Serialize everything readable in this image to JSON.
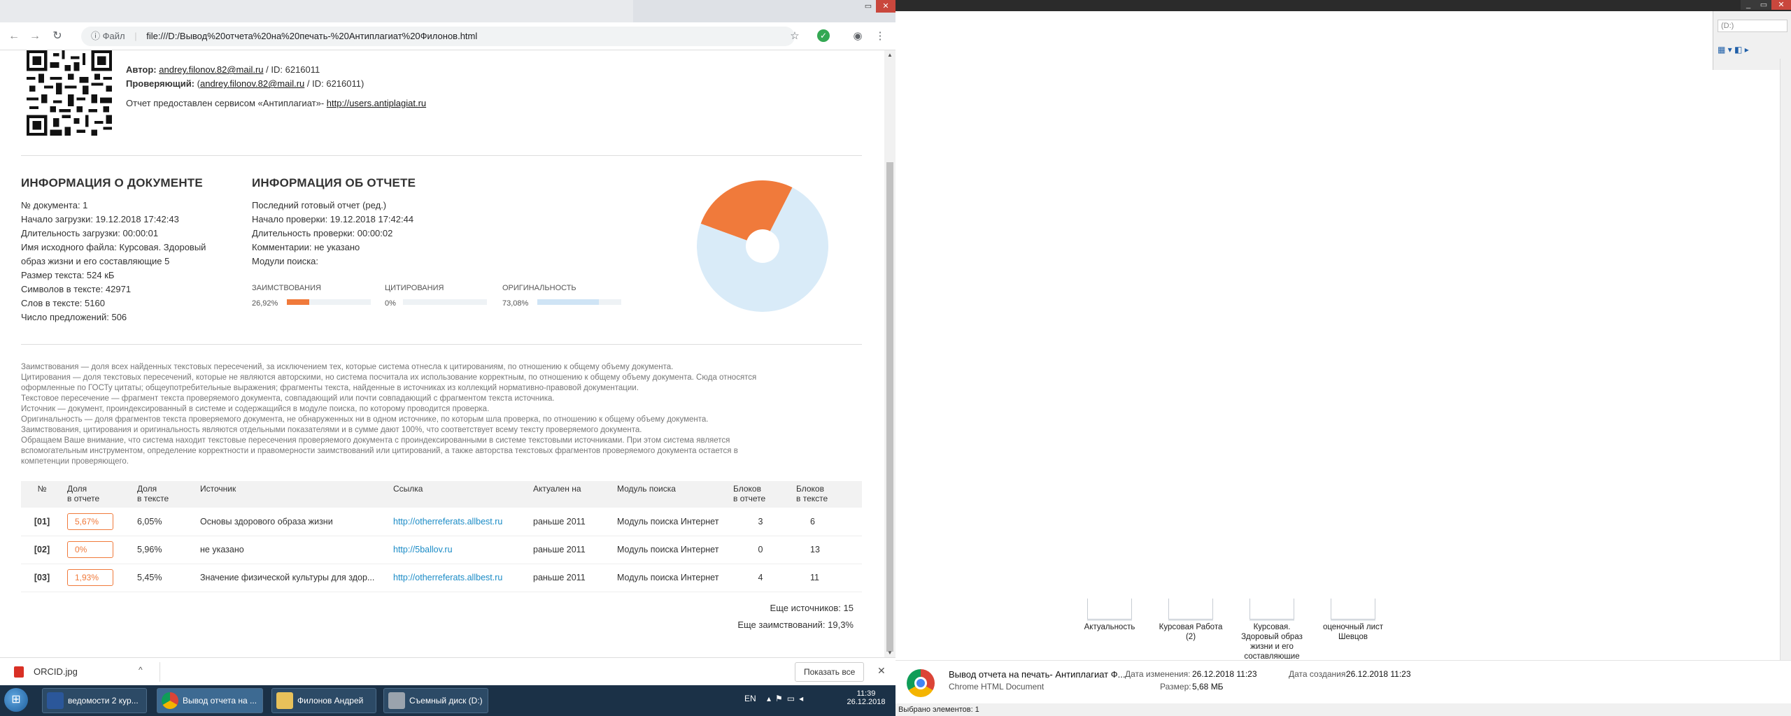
{
  "browser": {
    "url_label": "Файл",
    "url": "file:///D:/Вывод%20отчета%20на%20печать-%20Антиплагиат%20Филонов.html"
  },
  "report": {
    "author_label": "Автор:",
    "author_email": "andrey.filonov.82@mail.ru",
    "author_id": " / ID: 6216011",
    "checker_label": "Проверяющий:",
    "checker_email": "andrey.filonov.82@mail.ru",
    "checker_prefix": "(",
    "checker_id": " / ID: 6216011)",
    "service_text": "Отчет предоставлен сервисом «Антиплагиат»- ",
    "service_link": "http://users.antiplagiat.ru"
  },
  "doc_info": {
    "title": "ИНФОРМАЦИЯ О ДОКУМЕНТЕ",
    "lines": [
      "№ документа: 1",
      "Начало загрузки: 19.12.2018 17:42:43",
      "Длительность загрузки: 00:00:01",
      "Имя исходного файла: Курсовая. Здоровый",
      "образ жизни и его составляющие 5",
      "Размер текста: 524 кБ",
      "Символов в тексте: 42971",
      "Слов в тексте: 5160",
      "Число предложений: 506"
    ]
  },
  "report_info": {
    "title": "ИНФОРМАЦИЯ ОБ ОТЧЕТЕ",
    "lines": [
      "Последний готовый отчет (ред.)",
      "Начало проверки: 19.12.2018 17:42:44",
      "Длительность проверки: 00:00:02",
      "Комментарии: не указано",
      "Модули поиска:"
    ]
  },
  "metrics": [
    {
      "label": "ЗАИМСТВОВАНИЯ",
      "value": "26,92%",
      "fraction": 0.2692,
      "color": "#f07a3b"
    },
    {
      "label": "ЦИТИРОВАНИЯ",
      "value": "0%",
      "fraction": 0,
      "color": "#7cc36b"
    },
    {
      "label": "ОРИГИНАЛЬНОСТЬ",
      "value": "73,08%",
      "fraction": 0.7308,
      "color": "#cfe4f5"
    }
  ],
  "chart_data": {
    "type": "pie",
    "categories": [
      "Заимствования",
      "Цитирования",
      "Оригинальность"
    ],
    "values": [
      26.92,
      0,
      73.08
    ],
    "colors": [
      "#f07a3b",
      "#7cc36b",
      "#d9ebf8"
    ]
  },
  "legend_lines": [
    "Заимствования — доля всех найденных текстовых пересечений, за исключением тех, которые система отнесла к цитированиям, по отношению к общему объему документа.",
    "Цитирования — доля текстовых пересечений, которые не являются авторскими, но система посчитала их использование корректным, по отношению к общему объему документа. Сюда относятся",
    "оформленные по ГОСТу цитаты; общеупотребительные выражения; фрагменты текста, найденные в источниках из коллекций нормативно-правовой документации.",
    "Текстовое пересечение — фрагмент текста проверяемого документа, совпадающий или почти совпадающий с фрагментом текста источника.",
    "Источник — документ, проиндексированный в системе и содержащийся в модуле поиска, по которому проводится проверка.",
    "Оригинальность — доля фрагментов текста проверяемого документа, не обнаруженных ни в одном источнике, по которым шла проверка, по отношению к общему объему документа.",
    "Заимствования, цитирования и оригинальность являются отдельными показателями и в сумме дают 100%, что соответствует всему тексту проверяемого документа.",
    "Обращаем Ваше внимание, что система находит текстовые пересечения проверяемого документа с проиндексированными в системе текстовыми источниками. При этом система является",
    "вспомогательным инструментом, определение корректности и правомерности заимствований или цитирований, а также авторства текстовых фрагментов проверяемого документа остается в",
    "компетенции проверяющего."
  ],
  "table": {
    "headers": [
      "№",
      "Доля\nв отчете",
      "Доля\nв тексте",
      "Источник",
      "Ссылка",
      "Актуален на",
      "Модуль поиска",
      "Блоков\nв отчете",
      "Блоков\nв тексте"
    ],
    "rows": [
      [
        "[01]",
        "5,67%",
        "6,05%",
        "Основы здорового образа жизни",
        "http://otherreferats.allbest.ru",
        "раньше 2011",
        "Модуль поиска Интернет",
        "3",
        "6"
      ],
      [
        "[02]",
        "0%",
        "5,96%",
        "не указано",
        "http://5ballov.ru",
        "раньше 2011",
        "Модуль поиска Интернет",
        "0",
        "13"
      ],
      [
        "[03]",
        "1,93%",
        "5,45%",
        "Значение физической культуры для здор...",
        "http://otherreferats.allbest.ru",
        "раньше 2011",
        "Модуль поиска Интернет",
        "4",
        "11"
      ]
    ]
  },
  "summary": {
    "more_sources": "Еще источников: 15",
    "more_borrowings": "Еще заимствований: 19,3%"
  },
  "downloads": {
    "file": "ORCID.jpg",
    "show_all": "Показать все"
  },
  "taskbar": {
    "tasks": [
      "ведомости 2 кур...",
      "Вывод отчета на ...",
      "Филонов Андрей",
      "Съемный диск (D:)"
    ],
    "lang": "EN",
    "time": "11:39",
    "date": "26.12.2018"
  },
  "explorer": {
    "address_hint": "(D:)",
    "files": [
      "Актуальность",
      "Курсовая Работа (2)",
      "Курсовая. Здоровый образ жизни и его составляющие",
      "оценочный лист Шевцов"
    ],
    "detail_name": "Вывод отчета на печать- Антиплагиат Ф...",
    "detail_type": "Chrome HTML Document",
    "modified_label": "Дата изменения:",
    "modified": "26.12.2018 11:23",
    "size_label": "Размер:",
    "size": "5,68 МБ",
    "created_label": "Дата создания:",
    "created": "26.12.2018 11:23",
    "status": "Выбрано элементов: 1"
  }
}
